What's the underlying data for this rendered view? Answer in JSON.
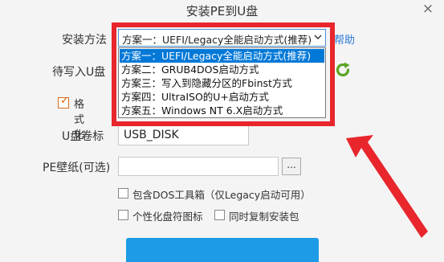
{
  "window": {
    "title": "安装PE到U盘",
    "close_glyph": "×"
  },
  "form": {
    "method_label": "安装方法",
    "disk_label": "待写入U盘",
    "format_label": "格式化",
    "format_checked": true,
    "volume_label": "U盘卷标",
    "volume_value": "USB_DISK",
    "wallpaper_label": "PE壁纸(可选)",
    "wallpaper_value": "",
    "browse_label": "...",
    "help_link": "帮助"
  },
  "method_select": {
    "selected": "方案一：UEFI/Legacy全能启动方式(推荐)",
    "options": [
      "方案一：UEFI/Legacy全能启动方式(推荐)",
      "方案二：GRUB4DOS启动方式",
      "方案三：写入到隐藏分区的Fbinst方式",
      "方案四：UltraISO的U+启动方式",
      "方案五：Windows NT 6.X启动方式"
    ],
    "highlighted_index": 0
  },
  "options": {
    "dos_toolbox": "包含DOS工具箱（仅Legacy启动可用）",
    "custom_icon": "个性化盘符图标",
    "copy_installer": "同时复制安装包",
    "dos_toolbox_checked": false,
    "custom_icon_checked": false,
    "copy_installer_checked": false
  },
  "icons": {
    "close": "close-icon",
    "dropdown_arrow": "chevron-down-icon",
    "refresh": "refresh-icon",
    "checkmark": "checkmark-icon"
  },
  "colors": {
    "accent_blue": "#1e9be6",
    "selection_blue": "#0078d7",
    "annotation_red": "#e8262c",
    "refresh_green": "#5aa423",
    "link_blue": "#2a78d6"
  }
}
